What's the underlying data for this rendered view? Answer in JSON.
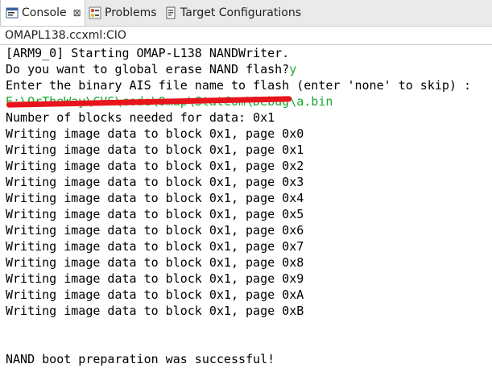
{
  "tabs": [
    {
      "label": "Console",
      "icon": "console-icon",
      "active": true,
      "close": "⊠"
    },
    {
      "label": "Problems",
      "icon": "problems-icon",
      "active": false
    },
    {
      "label": "Target Configurations",
      "icon": "target-config-icon",
      "active": false
    }
  ],
  "subtitle": "OMAPL138.ccxml:CIO",
  "console": {
    "lines": [
      {
        "text": "[ARM9_0] Starting OMAP-L138 NANDWriter."
      },
      {
        "text": "Do you want to global erase NAND flash?",
        "input": "y"
      },
      {
        "text": "Enter the binary AIS file name to flash (enter 'none' to skip) :"
      },
      {
        "text": "",
        "input": "E:\\OrTheWay\\CVS\\code\\Omap\\StatCom\\Debug\\a.bin"
      },
      {
        "text": "Number of blocks needed for data: 0x1"
      },
      {
        "text": "Writing image data to block 0x1, page 0x0"
      },
      {
        "text": "Writing image data to block 0x1, page 0x1"
      },
      {
        "text": "Writing image data to block 0x1, page 0x2"
      },
      {
        "text": "Writing image data to block 0x1, page 0x3"
      },
      {
        "text": "Writing image data to block 0x1, page 0x4"
      },
      {
        "text": "Writing image data to block 0x1, page 0x5"
      },
      {
        "text": "Writing image data to block 0x1, page 0x6"
      },
      {
        "text": "Writing image data to block 0x1, page 0x7"
      },
      {
        "text": "Writing image data to block 0x1, page 0x8"
      },
      {
        "text": "Writing image data to block 0x1, page 0x9"
      },
      {
        "text": "Writing image data to block 0x1, page 0xA"
      },
      {
        "text": "Writing image data to block 0x1, page 0xB"
      },
      {
        "text": ""
      },
      {
        "text": ""
      },
      {
        "text": "NAND boot preparation was successful!"
      }
    ]
  },
  "colors": {
    "input_text": "#1aa832",
    "redaction": "#e8141c"
  }
}
